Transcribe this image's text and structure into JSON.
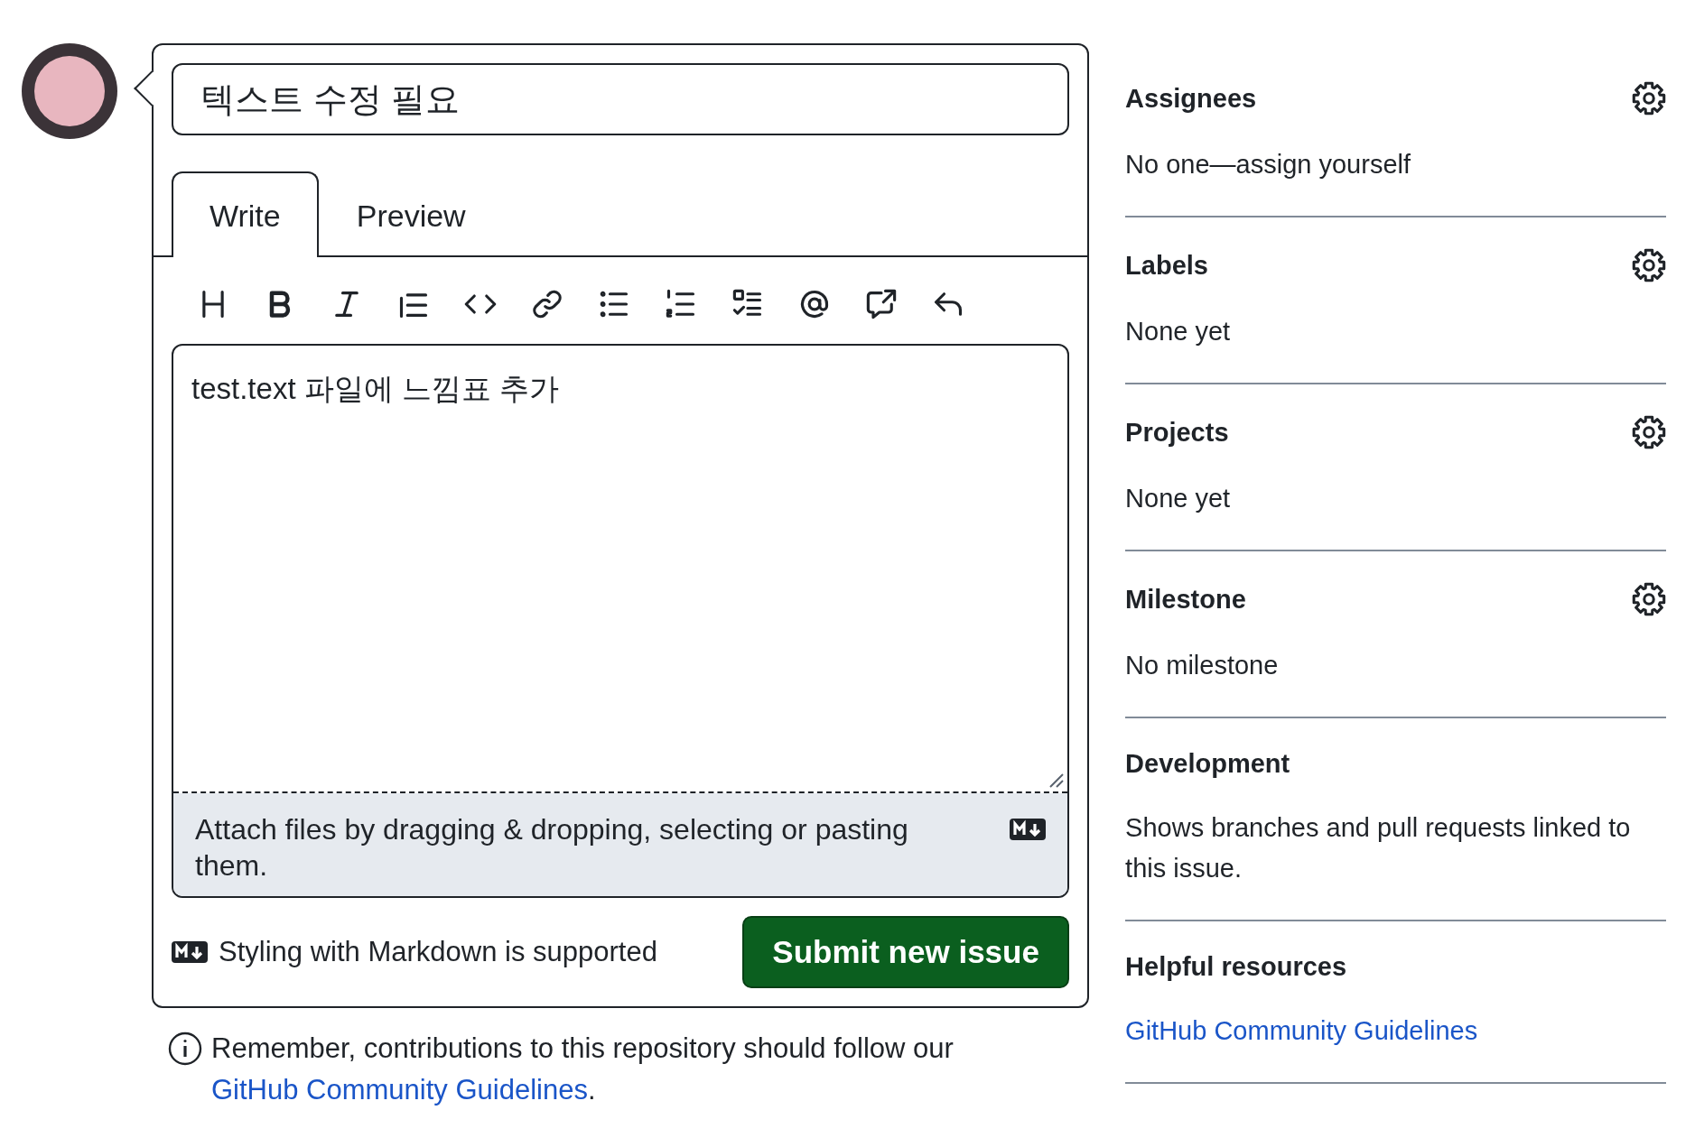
{
  "title_field": {
    "value": "텍스트 수정 필요"
  },
  "tabs": [
    {
      "label": "Write",
      "selected": true
    },
    {
      "label": "Preview",
      "selected": false
    }
  ],
  "editor": {
    "value": "test.text 파일에 느낌표 추가",
    "attach_hint": "Attach files by dragging & dropping, selecting or pasting them."
  },
  "markdown_note": "Styling with Markdown is supported",
  "submit_button": "Submit new issue",
  "contribution_note": {
    "text": "Remember, contributions to this repository should follow our ",
    "link": "GitHub Community Guidelines",
    "after": "."
  },
  "sidebar": [
    {
      "kind": "field",
      "heading": "Assignees",
      "value": "No one—assign yourself"
    },
    {
      "kind": "field",
      "heading": "Labels",
      "value": "None yet"
    },
    {
      "kind": "field",
      "heading": "Projects",
      "value": "None yet"
    },
    {
      "kind": "field",
      "heading": "Milestone",
      "value": "No milestone"
    },
    {
      "kind": "info",
      "heading": "Development",
      "value": "Shows branches and pull requests linked to this issue."
    },
    {
      "kind": "links",
      "heading": "Helpful resources",
      "value": "GitHub Community Guidelines"
    }
  ]
}
